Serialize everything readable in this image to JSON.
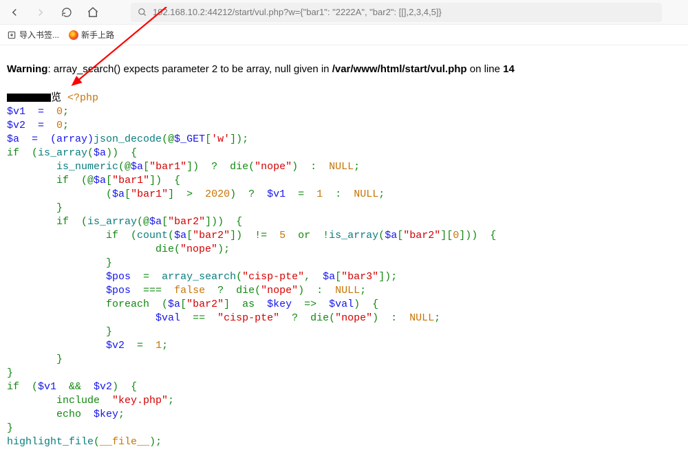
{
  "toolbar": {
    "url": "192.168.10.2:44212/start/vul.php?w={\"bar1\": \"2222A\", \"bar2\": [[],2,3,4,5]}"
  },
  "bookmarks": {
    "import_label": "导入书签...",
    "getting_started_label": "新手上路"
  },
  "warning": {
    "prefix": "Warning",
    "message": ": array_search() expects parameter 2 to be array, null given in ",
    "path": "/var/www/html/start/vul.php",
    "online": " on line ",
    "line": "14"
  },
  "code": {
    "redacted_suffix": "览 ",
    "php_open": "<?php",
    "l2a": "$v1  =  ",
    "l2b": "0",
    "l2c": ";",
    "l3a": "$v2  =  ",
    "l3b": "0",
    "l3c": ";",
    "l4a": "$a  =  (array)",
    "l4b": "json_decode",
    "l4c": "(@",
    "l4d": "$_GET",
    "l4e": "[",
    "l4f": "'w'",
    "l4g": "]);",
    "l5a": "if  (",
    "l5b": "is_array",
    "l5c": "(",
    "l5d": "$a",
    "l5e": "))  {",
    "l6a": "        ",
    "l6b": "is_numeric",
    "l6c": "(@",
    "l6d": "$a",
    "l6e": "[",
    "l6f": "\"bar1\"",
    "l6g": "])  ?  die(",
    "l6h": "\"nope\"",
    "l6i": ")  :  ",
    "l6j": "NULL",
    "l6k": ";",
    "l7a": "        if  (@",
    "l7b": "$a",
    "l7c": "[",
    "l7d": "\"bar1\"",
    "l7e": "])  {",
    "l8a": "                (",
    "l8b": "$a",
    "l8c": "[",
    "l8d": "\"bar1\"",
    "l8e": "]  >  ",
    "l8f": "2020",
    "l8g": ")  ?  ",
    "l8h": "$v1  ",
    "l8i": "=  ",
    "l8j": "1  ",
    "l8k": ":  ",
    "l8l": "NULL",
    "l8m": ";",
    "l9": "        }",
    "l10a": "        if  (",
    "l10b": "is_array",
    "l10c": "(@",
    "l10d": "$a",
    "l10e": "[",
    "l10f": "\"bar2\"",
    "l10g": "]))  {",
    "l11a": "                if  (",
    "l11b": "count",
    "l11c": "(",
    "l11d": "$a",
    "l11e": "[",
    "l11f": "\"bar2\"",
    "l11g": "])  !=  ",
    "l11h": "5  ",
    "l11i": "or  !",
    "l11j": "is_array",
    "l11k": "(",
    "l11l": "$a",
    "l11m": "[",
    "l11n": "\"bar2\"",
    "l11o": "][",
    "l11p": "0",
    "l11q": "]))  {",
    "l12a": "                        die(",
    "l12b": "\"nope\"",
    "l12c": ");",
    "l13": "                }",
    "l14a": "                ",
    "l14b": "$pos  ",
    "l14c": "=  ",
    "l14d": "array_search",
    "l14e": "(",
    "l14f": "\"cisp-pte\"",
    "l14g": ",  ",
    "l14h": "$a",
    "l14i": "[",
    "l14j": "\"bar3\"",
    "l14k": "]);",
    "l15a": "                ",
    "l15b": "$pos  ",
    "l15c": "===  ",
    "l15d": "false  ",
    "l15e": "?  die(",
    "l15f": "\"nope\"",
    "l15g": ")  :  ",
    "l15h": "NULL",
    "l15i": ";",
    "l16a": "                foreach  (",
    "l16b": "$a",
    "l16c": "[",
    "l16d": "\"bar2\"",
    "l16e": "]  as  ",
    "l16f": "$key  ",
    "l16g": "=>  ",
    "l16h": "$val",
    "l16i": ")  {",
    "l17a": "                        ",
    "l17b": "$val  ",
    "l17c": "==  ",
    "l17d": "\"cisp-pte\"  ",
    "l17e": "?  die(",
    "l17f": "\"nope\"",
    "l17g": ")  :  ",
    "l17h": "NULL",
    "l17i": ";",
    "l18": "                }",
    "l19a": "                ",
    "l19b": "$v2  ",
    "l19c": "=  ",
    "l19d": "1",
    "l19e": ";",
    "l20": "        }",
    "l21": "}",
    "l22a": "if  (",
    "l22b": "$v1  ",
    "l22c": "&&  ",
    "l22d": "$v2",
    "l22e": ")  {",
    "l23a": "        include  ",
    "l23b": "\"key.php\"",
    "l23c": ";",
    "l24a": "        echo  ",
    "l24b": "$key",
    "l24c": ";",
    "l25": "}",
    "l26a": "highlight_file",
    "l26b": "(",
    "l26c": "__file__",
    "l26d": ");"
  }
}
